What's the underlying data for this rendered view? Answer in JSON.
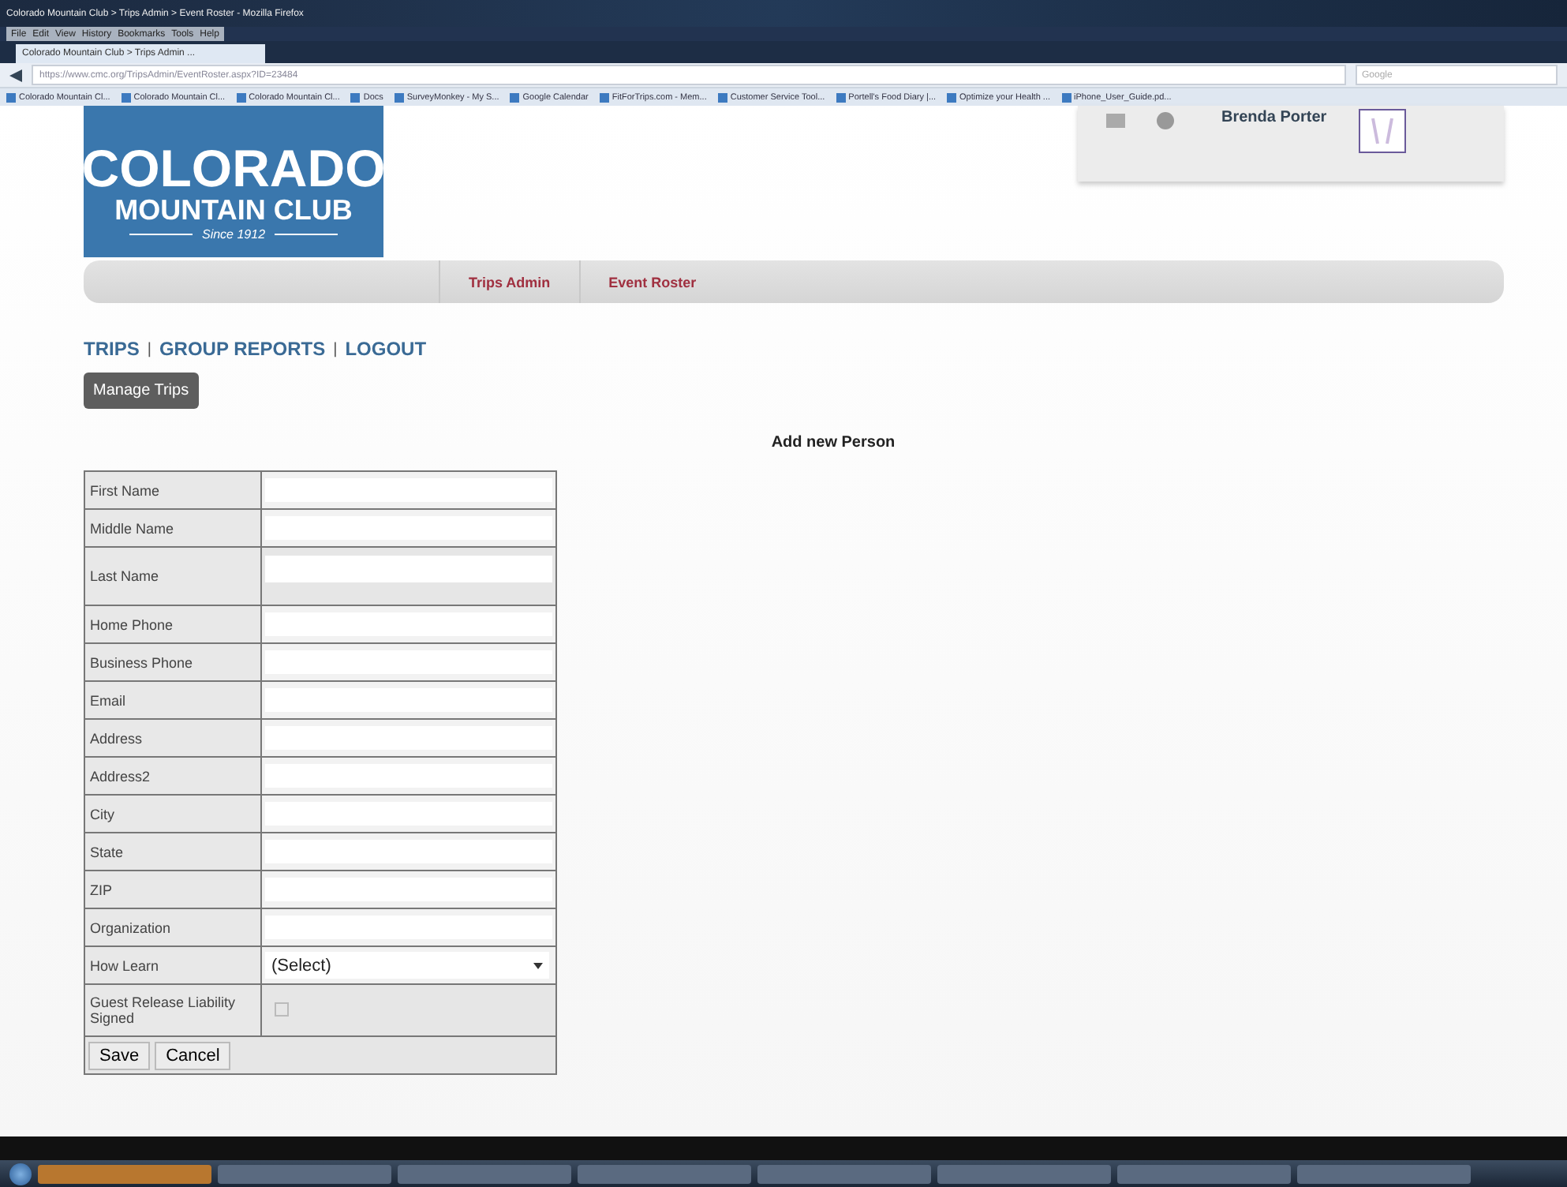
{
  "window": {
    "title": "Colorado Mountain Club > Trips Admin > Event Roster - Mozilla Firefox"
  },
  "menu": [
    "File",
    "Edit",
    "View",
    "History",
    "Bookmarks",
    "Tools",
    "Help"
  ],
  "tabs": [
    {
      "label": "Colorado Mountain Club > Trips Admin ...",
      "selected": true
    }
  ],
  "address_bar": {
    "url": "https://www.cmc.org/TripsAdmin/EventRoster.aspx?ID=23484",
    "search_placeholder": "Google"
  },
  "bookmarks": [
    "Colorado Mountain Cl...",
    "Colorado Mountain Cl...",
    "Colorado Mountain Cl...",
    "Docs",
    "SurveyMonkey - My S...",
    "Google Calendar",
    "FitForTrips.com - Mem...",
    "Customer Service Tool...",
    "Portell's Food Diary |...",
    "Optimize your Health ...",
    "iPhone_User_Guide.pd..."
  ],
  "logo": {
    "line1": "COLORADO",
    "line2": "MOUNTAIN CLUB",
    "tagline": "Since 1912"
  },
  "user": {
    "name": "Brenda Porter"
  },
  "breadcrumb": [
    "Trips Admin",
    "Event Roster"
  ],
  "nav_links": [
    "TRIPS",
    "GROUP REPORTS",
    "LOGOUT"
  ],
  "nav_separator": "|",
  "manage_button": "Manage Trips",
  "form": {
    "title": "Add new Person",
    "fields": [
      {
        "label": "First Name",
        "kind": "text"
      },
      {
        "label": "Middle Name",
        "kind": "text"
      },
      {
        "label": "Last Name",
        "kind": "tall"
      },
      {
        "label": "Home Phone",
        "kind": "text"
      },
      {
        "label": "Business Phone",
        "kind": "text"
      },
      {
        "label": "Email",
        "kind": "text"
      },
      {
        "label": "Address",
        "kind": "text"
      },
      {
        "label": "Address2",
        "kind": "text"
      },
      {
        "label": "City",
        "kind": "text"
      },
      {
        "label": "State",
        "kind": "text"
      },
      {
        "label": "ZIP",
        "kind": "text"
      },
      {
        "label": "Organization",
        "kind": "text"
      },
      {
        "label": "How Learn",
        "kind": "select",
        "value": "(Select)"
      },
      {
        "label": "Guest Release Liability Signed",
        "kind": "checkbox",
        "checked": false,
        "disabled": true
      }
    ],
    "buttons": [
      "Save",
      "Cancel"
    ]
  }
}
